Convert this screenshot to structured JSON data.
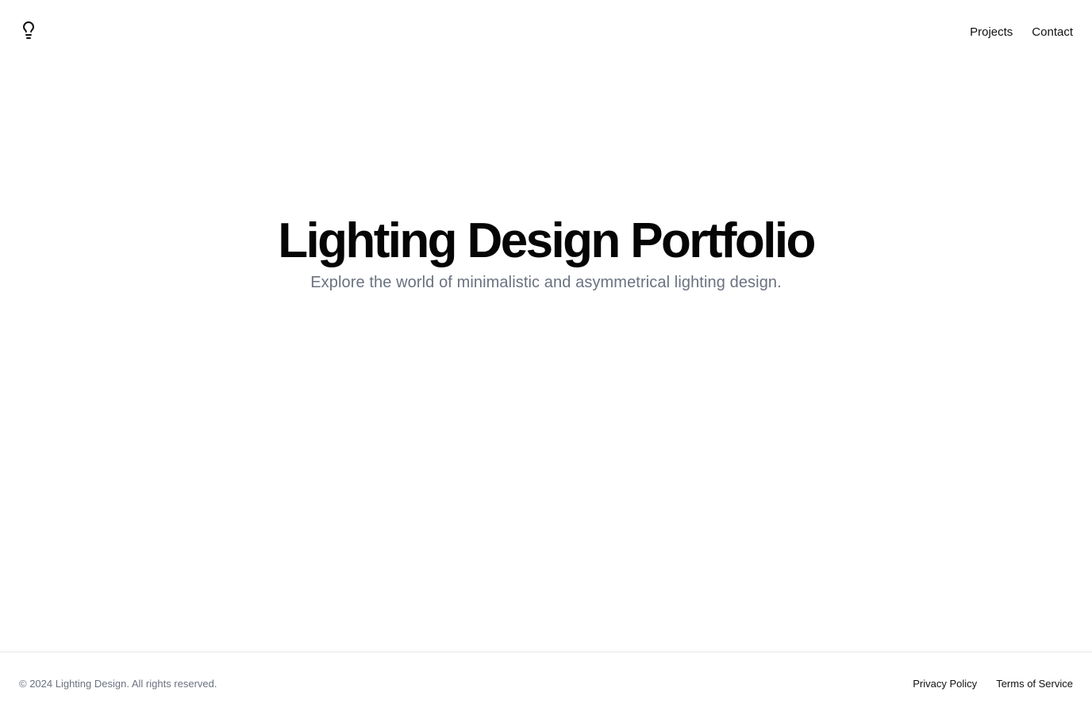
{
  "header": {
    "logo_icon": "lightbulb-icon",
    "nav": {
      "projects": "Projects",
      "contact": "Contact"
    }
  },
  "hero": {
    "title": "Lighting Design Portfolio",
    "subtitle": "Explore the world of minimalistic and asymmetrical lighting design."
  },
  "footer": {
    "copyright": "© 2024 Lighting Design. All rights reserved.",
    "links": {
      "privacy": "Privacy Policy",
      "terms": "Terms of Service"
    }
  },
  "colors": {
    "background": "#ffffff",
    "text_primary": "#0a0a0a",
    "text_muted": "#6b7280",
    "divider": "#e5e7eb"
  }
}
